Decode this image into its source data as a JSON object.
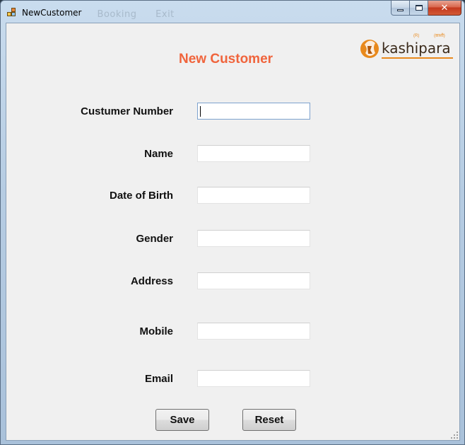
{
  "window": {
    "title": "NewCustomer",
    "ghost_menu": [
      "...",
      "Booking",
      "Exit"
    ],
    "close_glyph": "✕"
  },
  "form": {
    "heading": "New Customer",
    "accent_color": "#f0643c",
    "fields": [
      {
        "label": "Custumer Number",
        "value": ""
      },
      {
        "label": "Name",
        "value": ""
      },
      {
        "label": "Date of Birth",
        "value": ""
      },
      {
        "label": "Gender",
        "value": ""
      },
      {
        "label": "Address",
        "value": ""
      },
      {
        "label": "Mobile",
        "value": ""
      },
      {
        "label": "Email",
        "value": ""
      }
    ],
    "buttons": {
      "save": "Save",
      "reset": "Reset"
    }
  },
  "logo": {
    "brand_text": "kashipara",
    "accent_color": "#e8891c",
    "small_text_left": "(R)",
    "small_text_right": "(क़ाशी)"
  }
}
